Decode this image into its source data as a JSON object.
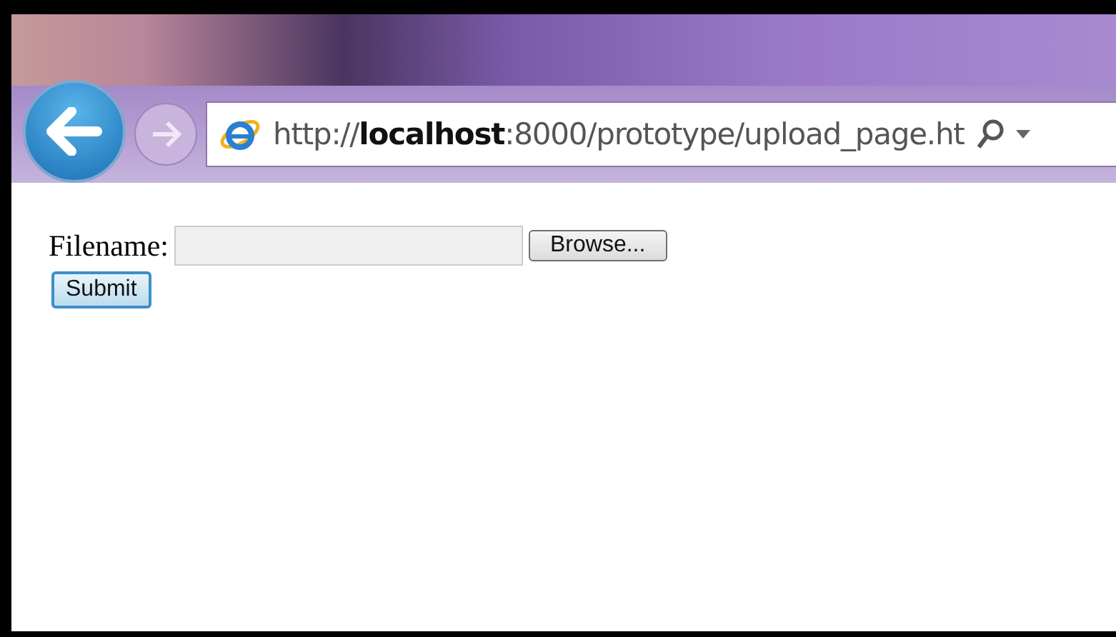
{
  "address_bar": {
    "url": "http://**localhost**:8000/prototype/upload_page.ht"
  },
  "form": {
    "label": "Filename:",
    "browse_button": "Browse...",
    "submit_button": "Submit"
  }
}
